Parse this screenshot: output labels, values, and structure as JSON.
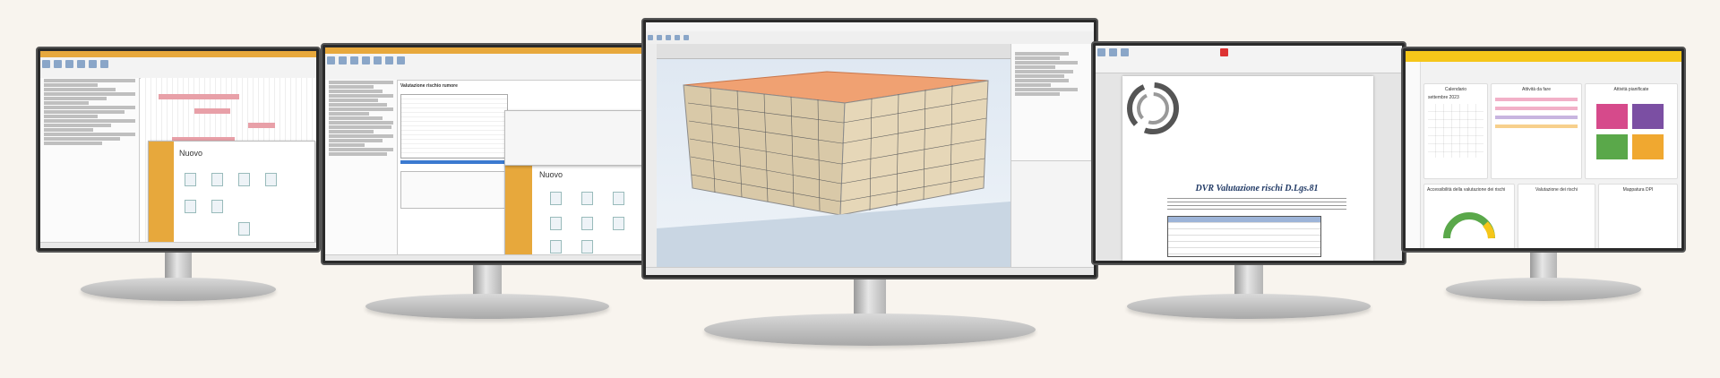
{
  "monitor1": {
    "dialog_title": "Nuovo",
    "app": "Gantt planner",
    "colors": {
      "accent": "#e7a83c",
      "gantt": "#e8a0a8"
    }
  },
  "monitor2": {
    "dialog_title": "Nuovo",
    "section_title": "Valutazione rischio rumore",
    "colors": {
      "accent": "#e7a83c"
    }
  },
  "monitor3": {
    "app": "3D scaffolding model",
    "colors": {
      "roof": "#f0a172",
      "sky": "#e6eef6"
    }
  },
  "monitor4": {
    "doc_title": "DVR Valutazione rischi D.Lgs.81",
    "colors": {
      "title": "#1f3864"
    }
  },
  "monitor5": {
    "widgets": [
      "Calendario",
      "Attività da fare",
      "Attività pianificate",
      "Accessibilità della valutazione dei rischi",
      "Valutazione dei rischi",
      "Mappatura DPI"
    ],
    "calendar_month": "settembre 2023",
    "colors": {
      "header": "#f5c61a",
      "pink": "#d64a8b",
      "purple": "#7b4fa3",
      "green": "#5aa84a",
      "orange": "#f0a830"
    }
  }
}
